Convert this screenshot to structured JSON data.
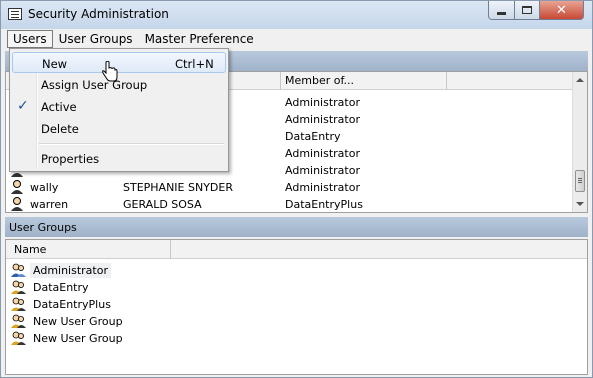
{
  "window": {
    "title": "Security Administration"
  },
  "menubar": {
    "items": [
      {
        "label": "Users"
      },
      {
        "label": "User Groups"
      },
      {
        "label": "Master Preference"
      }
    ]
  },
  "users_menu": {
    "items": [
      {
        "label": "New",
        "shortcut": "Ctrl+N",
        "highlighted": true
      },
      {
        "label": "Assign User Group"
      },
      {
        "label": "Active",
        "checked": true
      },
      {
        "label": "Delete"
      },
      {
        "label": "Properties"
      }
    ]
  },
  "users_panel": {
    "columns": [
      "Member of..."
    ],
    "rows": [
      {
        "login": "",
        "name": "",
        "member_of": "Administrator"
      },
      {
        "login": "",
        "name": "",
        "member_of": "Administrator"
      },
      {
        "login": "",
        "name": "",
        "member_of": "DataEntry"
      },
      {
        "login": "",
        "name": "",
        "member_of": "Administrator"
      },
      {
        "login": "",
        "name": "",
        "member_of": "Administrator"
      },
      {
        "login": "wally",
        "name": "STEPHANIE SNYDER",
        "member_of": "Administrator"
      },
      {
        "login": "warren",
        "name": "GERALD SOSA",
        "member_of": "DataEntryPlus"
      }
    ]
  },
  "groups_panel": {
    "title": "User Groups",
    "columns": [
      "Name"
    ],
    "rows": [
      {
        "name": "Administrator",
        "selected": true
      },
      {
        "name": "DataEntry"
      },
      {
        "name": "DataEntryPlus"
      },
      {
        "name": "New User Group"
      },
      {
        "name": "New User Group"
      }
    ]
  },
  "colors": {
    "panel_header": "#a9bcd3",
    "close_button": "#c74a34",
    "menu_highlight": "#dfeaf8",
    "check": "#1b4f9c"
  }
}
